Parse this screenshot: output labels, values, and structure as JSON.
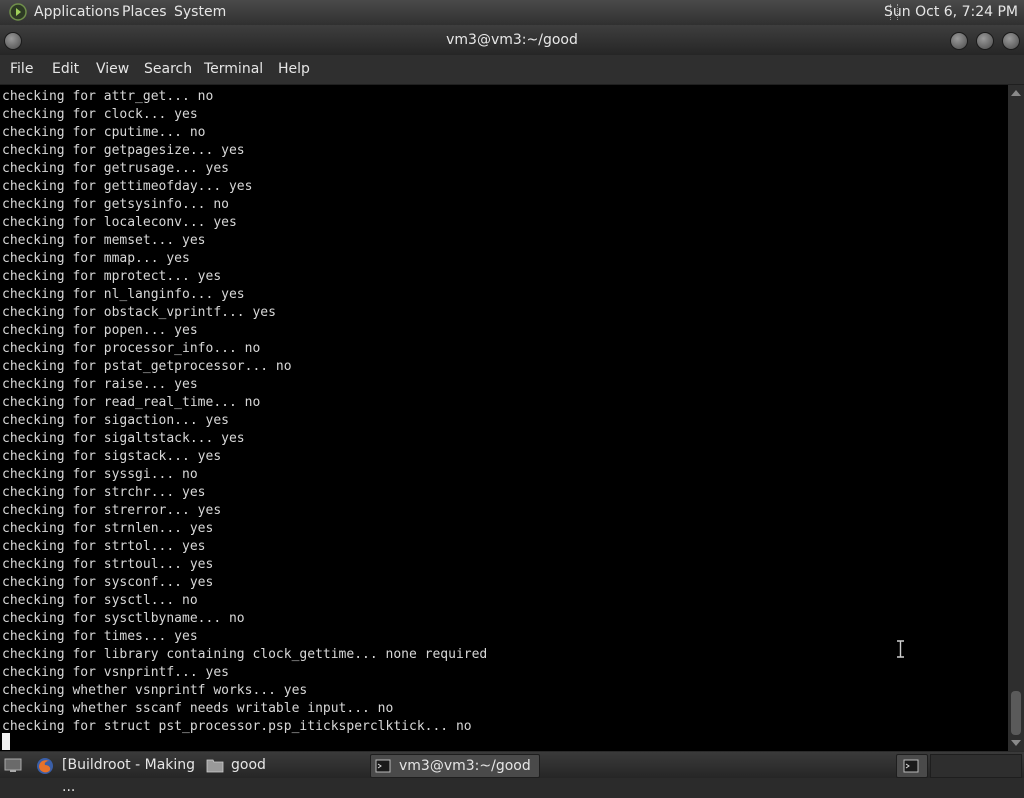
{
  "top_panel": {
    "menus": [
      "Applications",
      "Places",
      "System"
    ],
    "clock": "Sun Oct  6,  7:24 PM"
  },
  "window": {
    "title": "vm3@vm3:~/good"
  },
  "menubar": [
    "File",
    "Edit",
    "View",
    "Search",
    "Terminal",
    "Help"
  ],
  "terminal": {
    "lines": [
      "checking for attr_get... no",
      "checking for clock... yes",
      "checking for cputime... no",
      "checking for getpagesize... yes",
      "checking for getrusage... yes",
      "checking for gettimeofday... yes",
      "checking for getsysinfo... no",
      "checking for localeconv... yes",
      "checking for memset... yes",
      "checking for mmap... yes",
      "checking for mprotect... yes",
      "checking for nl_langinfo... yes",
      "checking for obstack_vprintf... yes",
      "checking for popen... yes",
      "checking for processor_info... no",
      "checking for pstat_getprocessor... no",
      "checking for raise... yes",
      "checking for read_real_time... no",
      "checking for sigaction... yes",
      "checking for sigaltstack... yes",
      "checking for sigstack... yes",
      "checking for syssgi... no",
      "checking for strchr... yes",
      "checking for strerror... yes",
      "checking for strnlen... yes",
      "checking for strtol... yes",
      "checking for strtoul... yes",
      "checking for sysconf... yes",
      "checking for sysctl... no",
      "checking for sysctlbyname... no",
      "checking for times... yes",
      "checking for library containing clock_gettime... none required",
      "checking for vsnprintf... yes",
      "checking whether vsnprintf works... yes",
      "checking whether sscanf needs writable input... no",
      "checking for struct pst_processor.psp_iticksperclktick... no"
    ]
  },
  "taskbar": {
    "tasks": [
      "[Buildroot - Making ...",
      "good",
      "vm3@vm3:~/good"
    ]
  },
  "icons": {
    "gnome": "gnome-foot-icon",
    "firefox": "firefox-icon",
    "folder": "folder-icon",
    "terminal": "terminal-icon",
    "show_desktop": "show-desktop-icon"
  }
}
